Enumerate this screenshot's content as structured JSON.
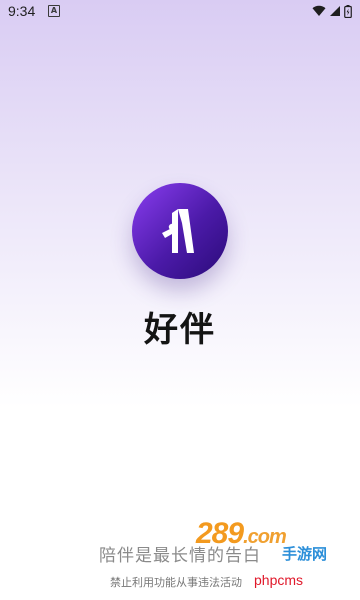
{
  "status_bar": {
    "time": "9:34",
    "app_icon_letter": "A",
    "icons": [
      "wifi-icon",
      "signal-icon",
      "battery-icon"
    ]
  },
  "splash": {
    "logo_icon": "app-logo-icon",
    "app_name": "好伴",
    "slogan": "陪伴是最长情的告白",
    "notice": "禁止利用功能从事违法活动"
  },
  "watermarks": {
    "site_logo": "289",
    "site_suffix": ".com",
    "site_name": "手游网",
    "tag": "phpcms"
  },
  "colors": {
    "logo_gradient_start": "#8a3df0",
    "logo_gradient_end": "#2a0b78",
    "background_top": "#d9ccf3",
    "watermark_orange": "#f39a1f",
    "watermark_blue": "#2c8fd9",
    "watermark_red": "#e0182a"
  }
}
